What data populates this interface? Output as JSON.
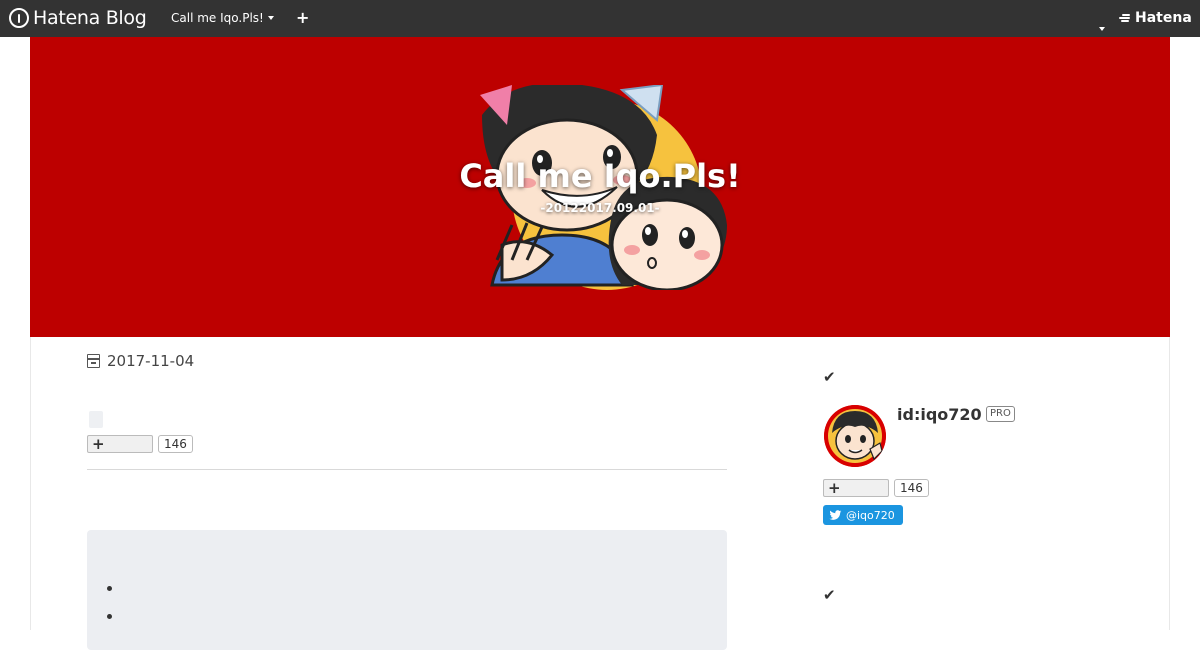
{
  "navbar": {
    "logo_text": "Hatena Blog",
    "blog_menu_label": "Call me Iqo.Pls!",
    "add_label": "+",
    "brand_label": "Hatena",
    "bg_color": "#333333"
  },
  "header": {
    "title": "Call me Iqo.Pls!",
    "description": "-20122017.09.01-",
    "bg_color": "#bd0000"
  },
  "entry": {
    "date": "2017-11-04",
    "bookmark_count": "146",
    "bookmark_add_label": "+"
  },
  "sidebar": {
    "user_id": "id:iqo720",
    "pro_badge": "PRO",
    "bookmark_count": "146",
    "bookmark_add_label": "+",
    "twitter_handle": "@iqo720",
    "twitter_color": "#1b95e0"
  },
  "icons": [
    "hatena-logo-icon",
    "plus-icon",
    "chevron-down-icon",
    "calendar-icon",
    "check-icon",
    "twitter-bird-icon"
  ]
}
